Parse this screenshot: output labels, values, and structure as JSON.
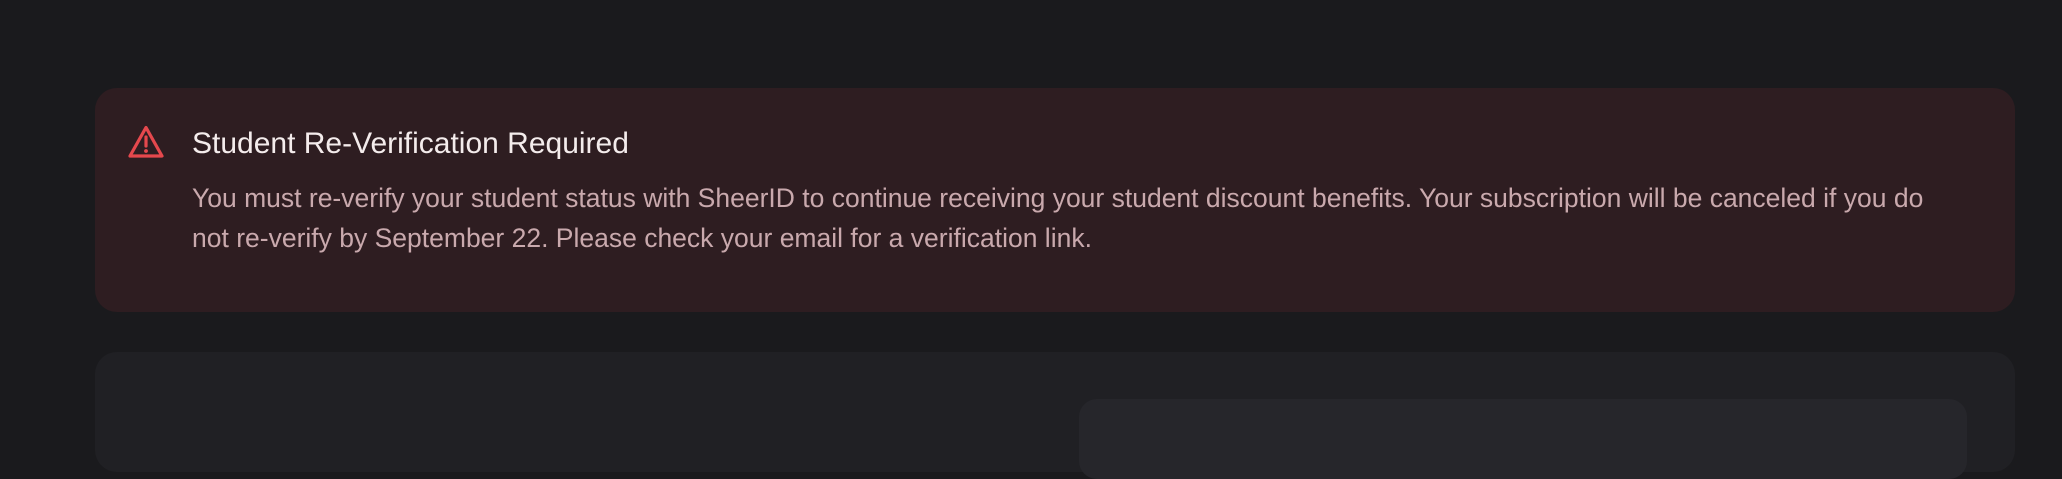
{
  "alert": {
    "icon": "warning-triangle-icon",
    "accent_color": "#e5484d",
    "title": "Student Re-Verification Required",
    "message": "You must re-verify your student status with SheerID to continue receiving your student discount benefits. Your subscription will be canceled if you do not re-verify by September 22. Please check your email for a verification link."
  },
  "colors": {
    "page_background": "#1a1a1d",
    "alert_background": "#2e1d21",
    "card_background": "#202024"
  }
}
